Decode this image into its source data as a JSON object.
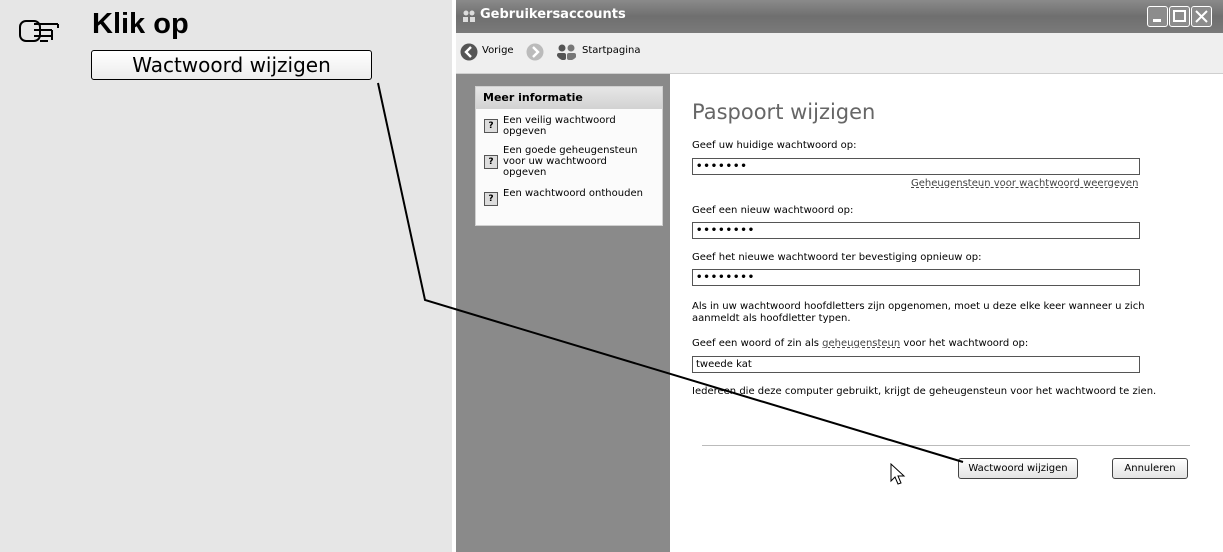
{
  "instruction": {
    "heading": "Klik op",
    "button_label": "Wactwoord wijzigen"
  },
  "window": {
    "title": "Gebruikersaccounts",
    "toolbar": {
      "back_label": "Vorige",
      "home_label": "Startpagina"
    },
    "sidebar": {
      "heading": "Meer informatie",
      "items": [
        {
          "label": "Een veilig wachtwoord opgeven"
        },
        {
          "label": "Een goede geheugensteun voor uw wachtwoord opgeven"
        },
        {
          "label": "Een wachtwoord onthouden"
        }
      ]
    },
    "main": {
      "title": "Paspoort wijzigen",
      "current_pw_label": "Geef uw huidige wachtwoord op:",
      "current_pw_value": "•••••••",
      "hint_link": "Geheugensteun voor wachtwoord weergeven",
      "new_pw_label": "Geef een nieuw wachtwoord op:",
      "new_pw_value": "••••••••",
      "confirm_pw_label": "Geef het nieuwe wachtwoord ter bevestiging opnieuw op:",
      "confirm_pw_value": "••••••••",
      "caps_note": "Als in uw wachtwoord hoofdletters zijn opgenomen, moet u deze elke keer wanneer u zich aanmeldt als hoofdletter typen.",
      "hint_label_pre": "Geef een woord of zin als ",
      "hint_label_link": "geheugensteun",
      "hint_label_post": " voor het wachtwoord op:",
      "hint_value": "tweede kat",
      "hint_note": "Iedereen die deze computer gebruikt, krijgt de geheugensteun voor het wachtwoord te zien.",
      "change_button": "Wactwoord wijzigen",
      "cancel_button": "Annuleren"
    }
  }
}
